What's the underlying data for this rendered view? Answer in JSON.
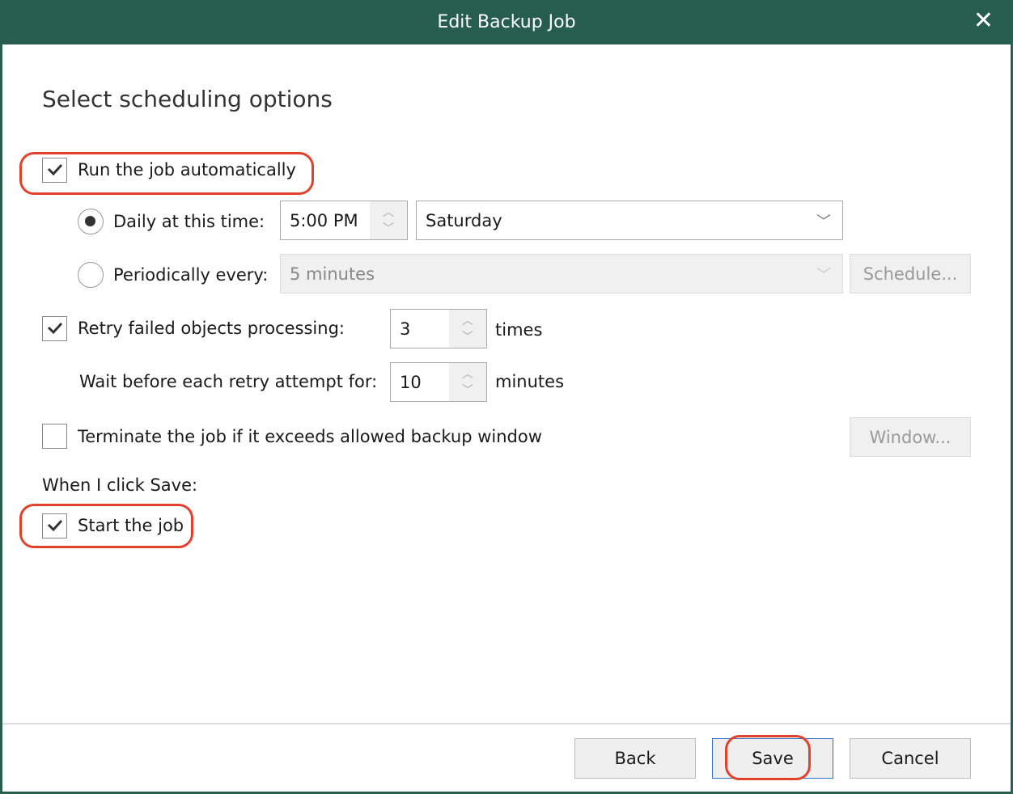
{
  "window": {
    "title": "Edit Backup Job",
    "close_icon": "close-icon"
  },
  "heading": "Select scheduling options",
  "run_auto": {
    "label": "Run the job automatically",
    "checked": true
  },
  "daily": {
    "label": "Daily at this time:",
    "selected": true,
    "time": "5:00 PM",
    "day": "Saturday"
  },
  "periodic": {
    "label": "Periodically every:",
    "selected": false,
    "interval": "5 minutes",
    "schedule_button": "Schedule..."
  },
  "retry": {
    "label": "Retry failed objects processing:",
    "checked": true,
    "count": "3",
    "count_unit": "times",
    "wait_label": "Wait before each retry attempt for:",
    "wait": "10",
    "wait_unit": "minutes"
  },
  "terminate": {
    "label": "Terminate the job if it exceeds allowed backup window",
    "checked": false,
    "window_button": "Window..."
  },
  "on_save": {
    "label": "When I click Save:",
    "start_label": "Start the job",
    "checked": true
  },
  "footer": {
    "back": "Back",
    "save": "Save",
    "cancel": "Cancel"
  },
  "highlight_color": "#e2412c"
}
